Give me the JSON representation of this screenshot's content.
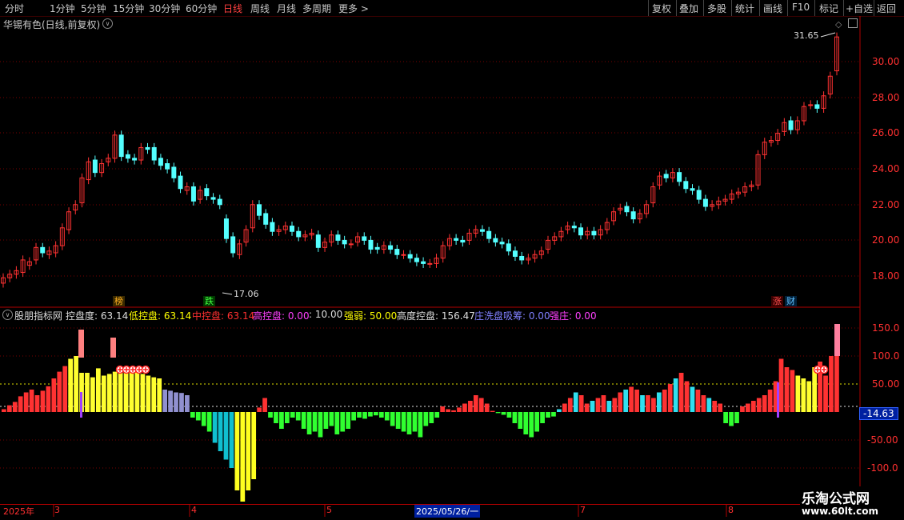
{
  "toolbar": {
    "periods": [
      "分时",
      "1分钟",
      "5分钟",
      "15分钟",
      "30分钟",
      "60分钟",
      "日线",
      "周线",
      "月线",
      "多周期",
      "更多 >"
    ],
    "active_period": "日线",
    "right_buttons": [
      "复权",
      "叠加",
      "多股",
      "统计",
      "画线",
      "F10",
      "标记",
      "+自选",
      "返回"
    ]
  },
  "main_chart": {
    "title": "华锡有色(日线,前复权)",
    "high_label": "31.65",
    "low_label": "17.06",
    "y_ticks": [
      "30.00",
      "28.00",
      "26.00",
      "24.00",
      "22.00",
      "20.00",
      "18.00"
    ],
    "tags": {
      "bang": "榜",
      "die": "跌",
      "zhang": "涨",
      "cai": "财"
    }
  },
  "indicator": {
    "name": "股朋指标网",
    "items": [
      {
        "label": "控盘度:",
        "value": "63.14",
        "color": "#dcdcdc"
      },
      {
        "label": "低控盘:",
        "value": "63.14",
        "color": "#ffff00"
      },
      {
        "label": "中控盘:",
        "value": "63.14",
        "color": "#ff3030"
      },
      {
        "label": "高控盘:",
        "value": "0.00",
        "color": "#ff40ff"
      },
      {
        "label": ":",
        "value": "10.00",
        "color": "#dcdcdc"
      },
      {
        "label": "强弱:",
        "value": "50.00",
        "color": "#ffff00"
      },
      {
        "label": "高度控盘:",
        "value": "156.47",
        "color": "#dcdcdc"
      },
      {
        "label": "庄洗盘吸筹:",
        "value": "0.00",
        "color": "#8080ff"
      },
      {
        "label": "强庄:",
        "value": "0.00",
        "color": "#ff40ff"
      }
    ],
    "y_ticks": [
      "150.0",
      "100.0",
      "50.00",
      "-50.00",
      "-100.0"
    ],
    "current_value": "-14.63"
  },
  "date_axis": {
    "labels": [
      "2025年",
      "3",
      "4",
      "5",
      "2025/05/26/一",
      "7",
      "8"
    ]
  },
  "watermark": {
    "line1": "乐淘公式网",
    "line2": "www.60lt.com"
  },
  "colors": {
    "up": "#ff3232",
    "down": "#54ffff",
    "bg": "#000000",
    "grid": "#7a0000"
  }
}
